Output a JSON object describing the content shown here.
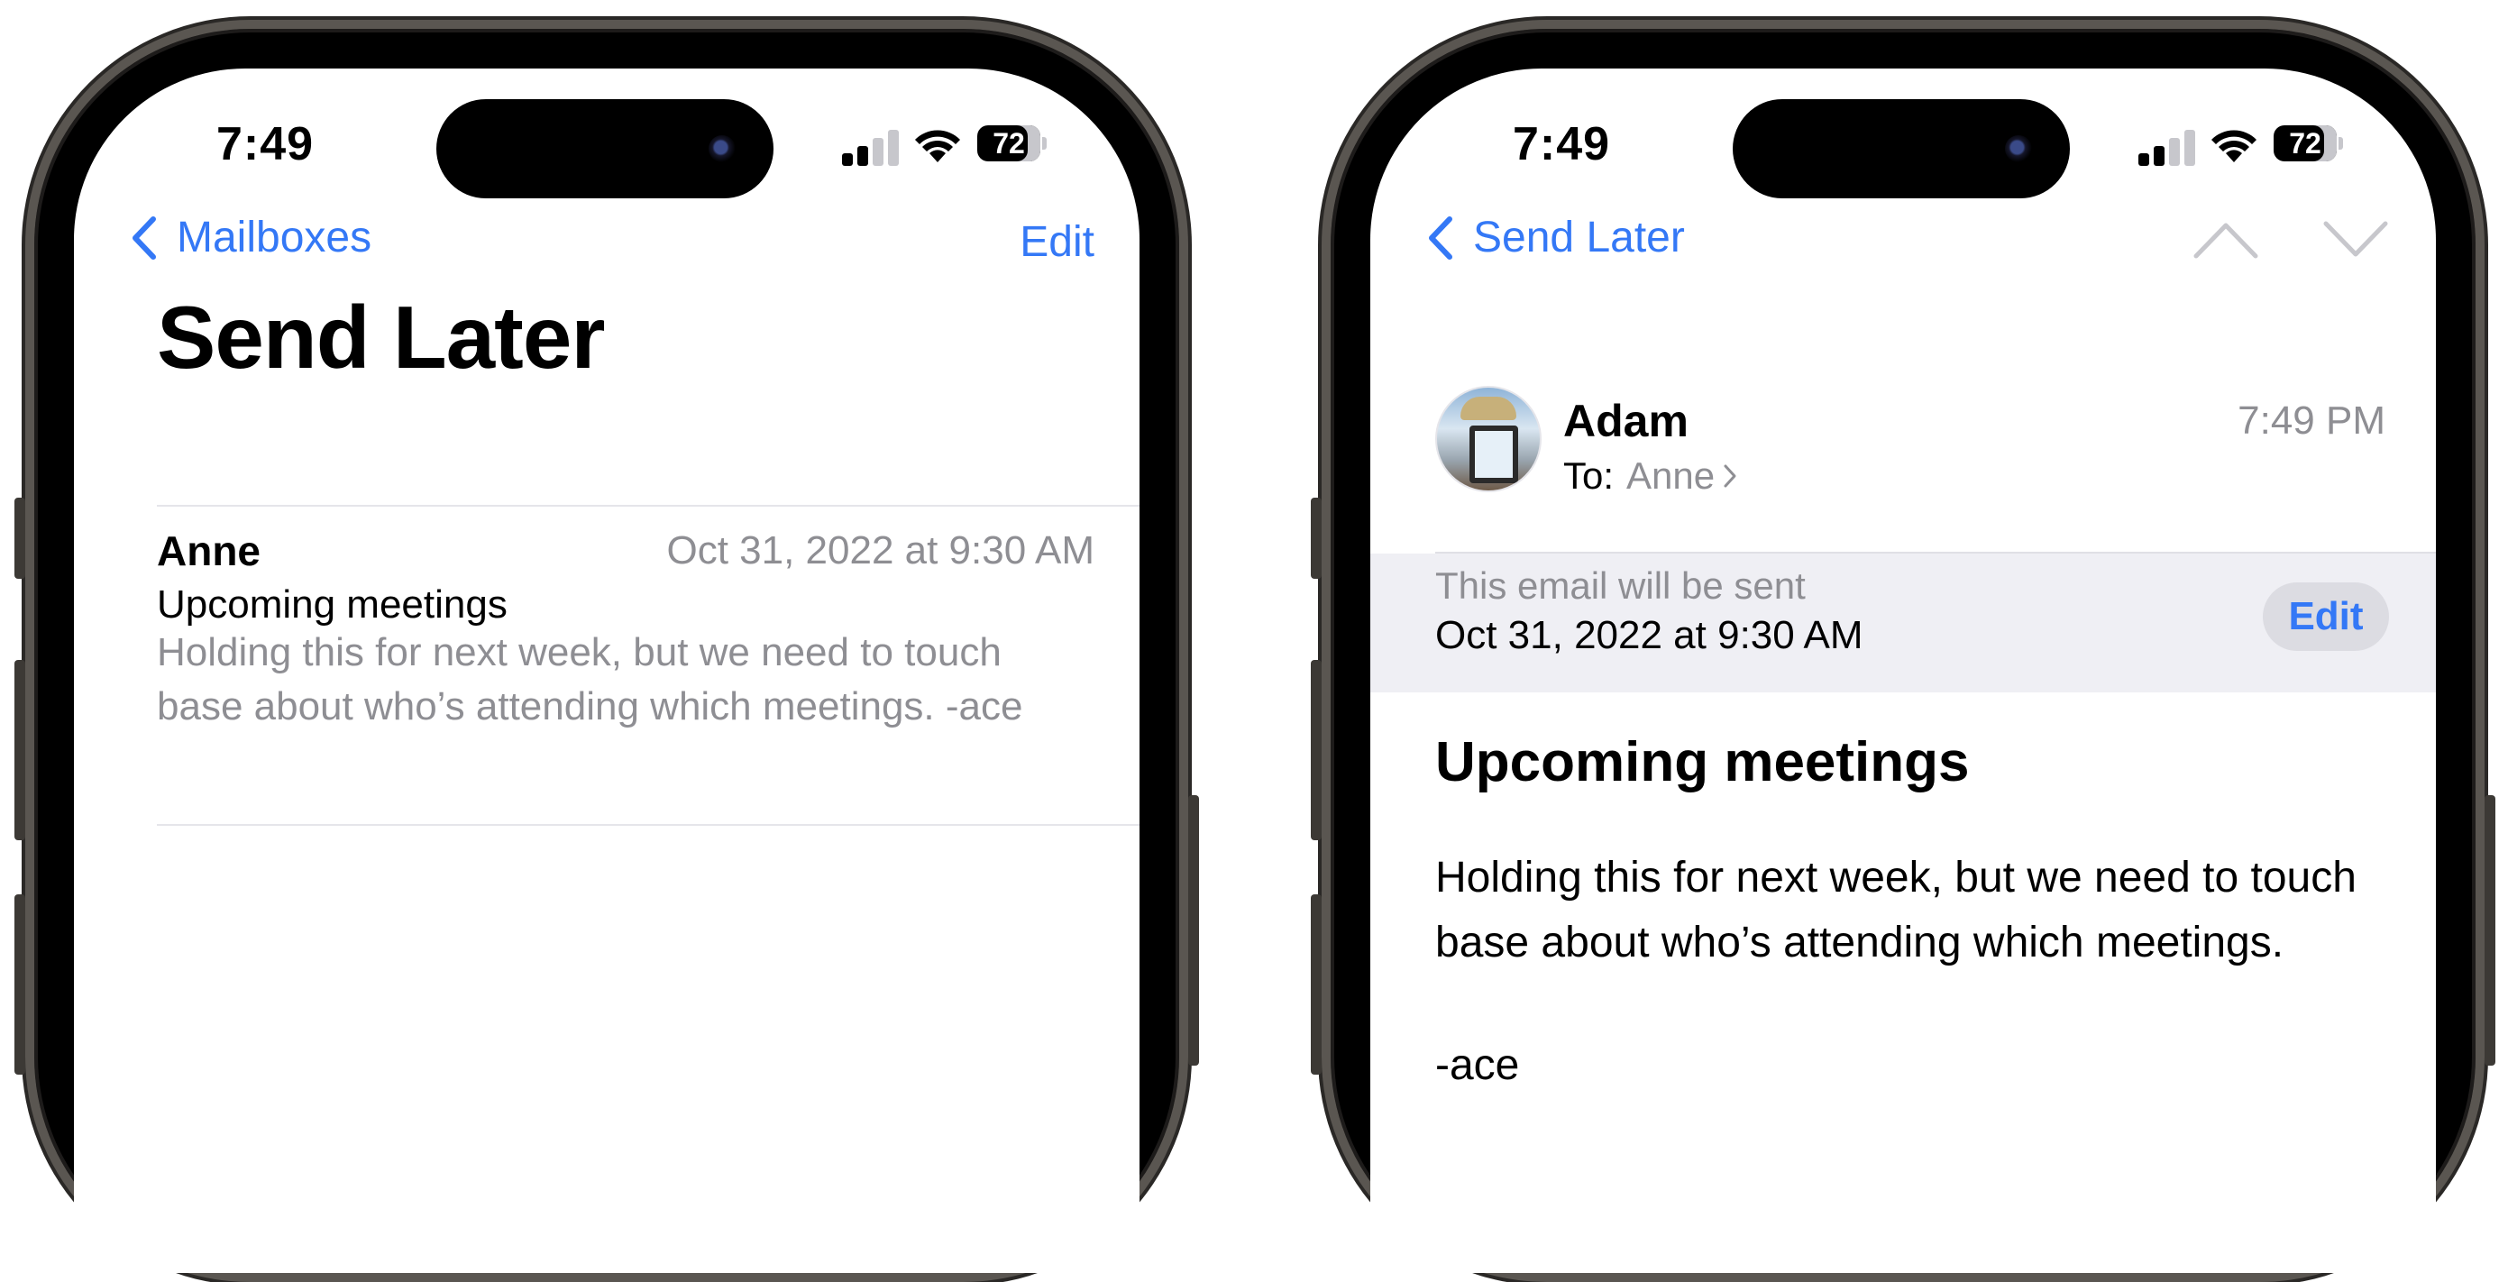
{
  "left_screen": {
    "status": {
      "time": "7:49",
      "battery": "72"
    },
    "nav": {
      "back_label": "Mailboxes",
      "edit_label": "Edit"
    },
    "title": "Send Later",
    "message": {
      "sender": "Anne",
      "date": "Oct 31, 2022 at 9:30 AM",
      "subject": "Upcoming meetings",
      "preview": "Holding this for next week, but we need to touch base about who’s attending which meetings. -ace"
    }
  },
  "right_screen": {
    "status": {
      "time": "7:49",
      "battery": "72"
    },
    "nav": {
      "back_label": "Send Later"
    },
    "header": {
      "sender": "Adam",
      "to_label": "To:",
      "recipient": "Anne",
      "time": "7:49 PM"
    },
    "schedule": {
      "label": "This email will be sent",
      "date": "Oct 31, 2022 at 9:30 AM",
      "edit_label": "Edit"
    },
    "message": {
      "subject": "Upcoming meetings",
      "body": "Holding this for next week, but we need to touch base about who’s attending which meetings.",
      "signoff": "-ace"
    }
  },
  "colors": {
    "accent": "#3478f6",
    "secondary_text": "#8e8e93",
    "schedule_band": "#efeff4"
  },
  "icons": [
    "chevron-left-icon",
    "chevron-up-icon",
    "chevron-down-icon",
    "chevron-right-icon",
    "cellular-signal-icon",
    "wifi-icon",
    "battery-icon"
  ]
}
